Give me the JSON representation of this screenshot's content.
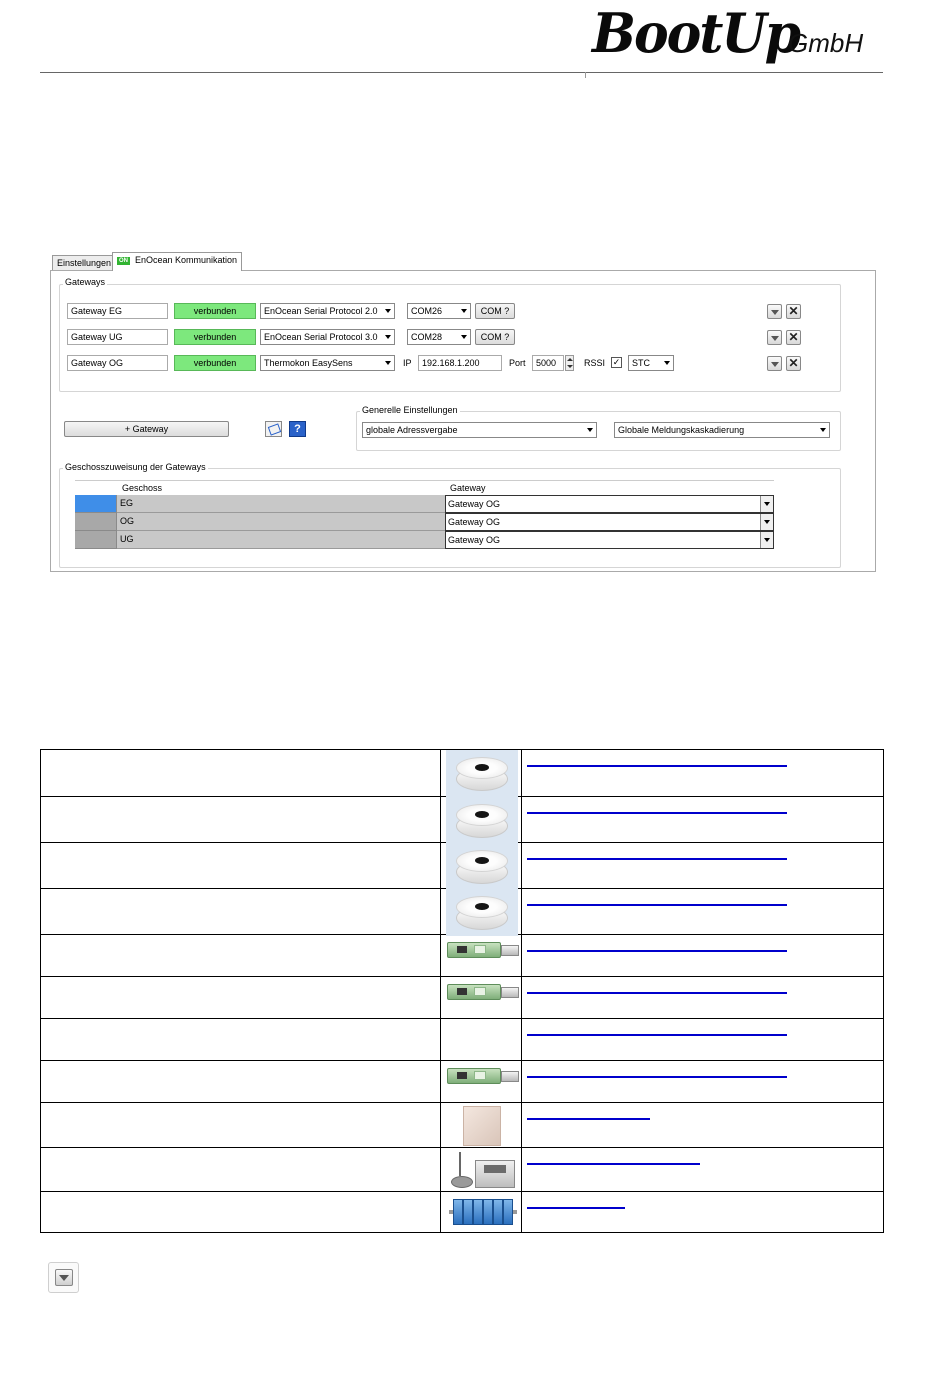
{
  "header": {
    "logo_main": "BootUp",
    "logo_suffix": "GmbH"
  },
  "dialog": {
    "tabs": [
      {
        "label": "Einstellungen"
      },
      {
        "label": "EnOcean Kommunikation",
        "badge": "ON"
      }
    ],
    "gateways_group_title": "Gateways",
    "gateways": [
      {
        "name": "Gateway EG",
        "status": "verbunden",
        "protocol": "EnOcean Serial Protocol 2.0",
        "port": "COM26",
        "com_button": "COM ?"
      },
      {
        "name": "Gateway UG",
        "status": "verbunden",
        "protocol": "EnOcean Serial Protocol 3.0",
        "port": "COM28",
        "com_button": "COM ?"
      },
      {
        "name": "Gateway OG",
        "status": "verbunden",
        "protocol": "Thermokon EasySens",
        "ip_label": "IP",
        "ip": "192.168.1.200",
        "port_label": "Port",
        "port_value": "5000",
        "rssi_label": "RSSI",
        "rssi_checked": true,
        "mode": "STC"
      }
    ],
    "add_gateway_button": "+ Gateway",
    "general_group_title": "Generelle Einstellungen",
    "address_assignment": "globale Adressvergabe",
    "message_cascading": "Globale Meldungskaskadierung",
    "floor_group_title": "Geschosszuweisung der Gateways",
    "grid": {
      "columns": [
        "Geschoss",
        "Gateway"
      ],
      "rows": [
        {
          "floor": "EG",
          "gateway": "Gateway OG",
          "selected": true
        },
        {
          "floor": "OG",
          "gateway": "Gateway OG",
          "selected": false
        },
        {
          "floor": "UG",
          "gateway": "Gateway OG",
          "selected": false
        }
      ]
    }
  },
  "device_table": {
    "rows": [
      {
        "image": "ceiling-sensor"
      },
      {
        "image": "ceiling-sensor"
      },
      {
        "image": "ceiling-sensor"
      },
      {
        "image": "ceiling-sensor"
      },
      {
        "image": "usb-stick"
      },
      {
        "image": "usb-stick"
      },
      {
        "image": "none"
      },
      {
        "image": "usb-stick"
      },
      {
        "image": "wall-box"
      },
      {
        "image": "gateway-antenna"
      },
      {
        "image": "din-rail-modules"
      }
    ],
    "link_widths_pct": [
      72,
      72,
      72,
      72,
      72,
      72,
      72,
      72,
      34,
      48,
      27
    ]
  },
  "icons": [
    "move-down-icon",
    "delete-icon",
    "wizard-icon",
    "help-icon"
  ]
}
